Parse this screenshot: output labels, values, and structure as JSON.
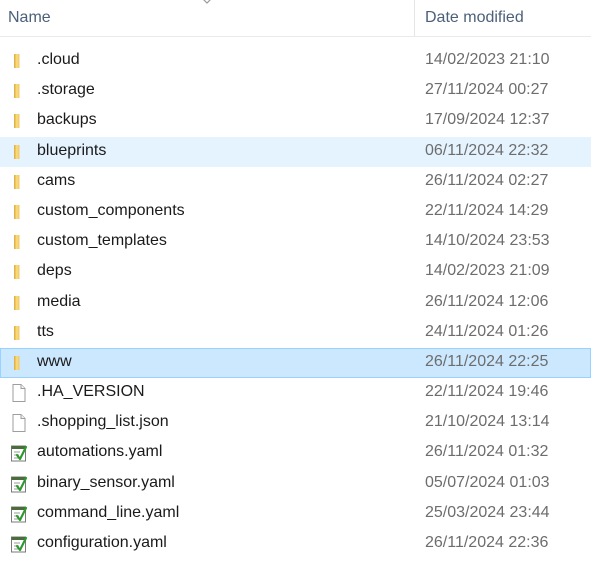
{
  "header": {
    "name_label": "Name",
    "date_label": "Date modified"
  },
  "colors": {
    "header_text": "#4c607a",
    "hover_row": "#e5f3ff",
    "selected_row": "#cce8ff",
    "folder": "#f8d775"
  },
  "rows": [
    {
      "name": ".cloud",
      "date": "14/02/2023 21:10",
      "type": "folder",
      "state": ""
    },
    {
      "name": ".storage",
      "date": "27/11/2024 00:27",
      "type": "folder",
      "state": ""
    },
    {
      "name": "backups",
      "date": "17/09/2024 12:37",
      "type": "folder",
      "state": ""
    },
    {
      "name": "blueprints",
      "date": "06/11/2024 22:32",
      "type": "folder",
      "state": "hover"
    },
    {
      "name": "cams",
      "date": "26/11/2024 02:27",
      "type": "folder",
      "state": ""
    },
    {
      "name": "custom_components",
      "date": "22/11/2024 14:29",
      "type": "folder",
      "state": ""
    },
    {
      "name": "custom_templates",
      "date": "14/10/2024 23:53",
      "type": "folder",
      "state": ""
    },
    {
      "name": "deps",
      "date": "14/02/2023 21:09",
      "type": "folder",
      "state": ""
    },
    {
      "name": "media",
      "date": "26/11/2024 12:06",
      "type": "folder",
      "state": ""
    },
    {
      "name": "tts",
      "date": "24/11/2024 01:26",
      "type": "folder",
      "state": ""
    },
    {
      "name": "www",
      "date": "26/11/2024 22:25",
      "type": "folder",
      "state": "selected"
    },
    {
      "name": ".HA_VERSION",
      "date": "22/11/2024 19:46",
      "type": "file",
      "state": ""
    },
    {
      "name": ".shopping_list.json",
      "date": "21/10/2024 13:14",
      "type": "file",
      "state": ""
    },
    {
      "name": "automations.yaml",
      "date": "26/11/2024 01:32",
      "type": "yaml",
      "state": ""
    },
    {
      "name": "binary_sensor.yaml",
      "date": "05/07/2024 01:03",
      "type": "yaml",
      "state": ""
    },
    {
      "name": "command_line.yaml",
      "date": "25/03/2024 23:44",
      "type": "yaml",
      "state": ""
    },
    {
      "name": "configuration.yaml",
      "date": "26/11/2024 22:36",
      "type": "yaml",
      "state": ""
    }
  ]
}
